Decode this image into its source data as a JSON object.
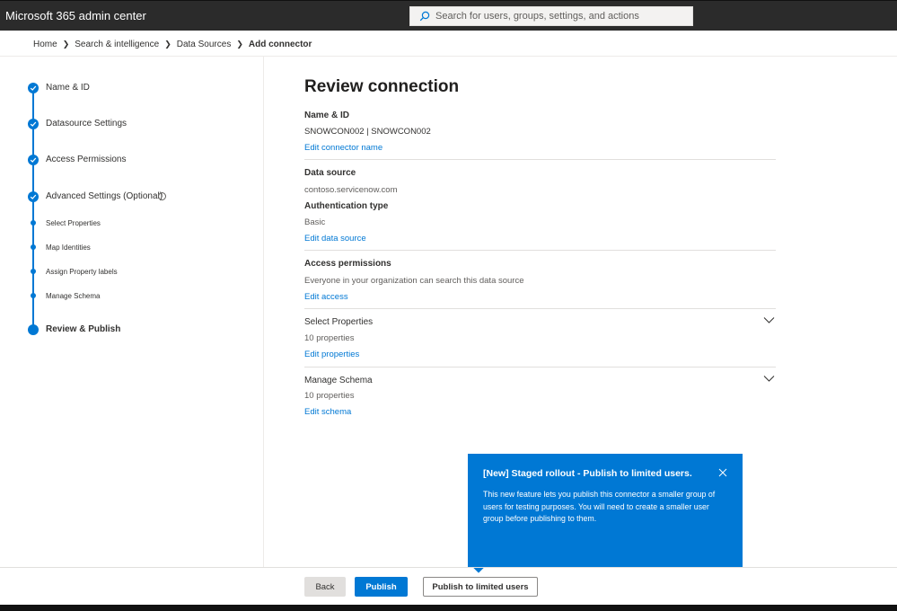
{
  "app": {
    "title": "Microsoft 365 admin center"
  },
  "search": {
    "placeholder": "Search for users, groups, settings, and actions",
    "icon": "search-icon"
  },
  "breadcrumb": {
    "items": [
      "Home",
      "Search & intelligence",
      "Data Sources"
    ],
    "current": "Add connector"
  },
  "steps": {
    "name_id": "Name & ID",
    "datasource_settings": "Datasource Settings",
    "access_permissions": "Access Permissions",
    "advanced_settings": "Advanced Settings (Optional)",
    "sub_steps": [
      "Select Properties",
      "Map Identities",
      "Assign Property labels",
      "Manage Schema"
    ],
    "review_publish": "Review & Publish"
  },
  "main": {
    "title": "Review connection",
    "name_id": {
      "heading": "Name & ID",
      "value": "SNOWCON002 | SNOWCON002",
      "link": "Edit connector name"
    },
    "data_source": {
      "heading": "Data source",
      "value": "contoso.servicenow.com",
      "auth_heading": "Authentication type",
      "auth_value": "Basic",
      "link": "Edit data source"
    },
    "access": {
      "heading": "Access permissions",
      "value": "Everyone in your organization can search this data source",
      "link": "Edit access"
    },
    "select_properties": {
      "heading": "Select Properties",
      "value": "10 properties",
      "link": "Edit properties"
    },
    "manage_schema": {
      "heading": "Manage Schema",
      "value": "10 properties",
      "link": "Edit schema"
    }
  },
  "callout": {
    "title": "[New] Staged rollout - Publish to limited users.",
    "body": "This new feature lets you publish this connector a smaller group of users for testing purposes. You will need to create a smaller user group before publishing to them."
  },
  "footer": {
    "back": "Back",
    "publish": "Publish",
    "publish_limited": "Publish to limited users"
  },
  "colors": {
    "accent": "#0078d4",
    "topbar": "#2b2b2b"
  }
}
